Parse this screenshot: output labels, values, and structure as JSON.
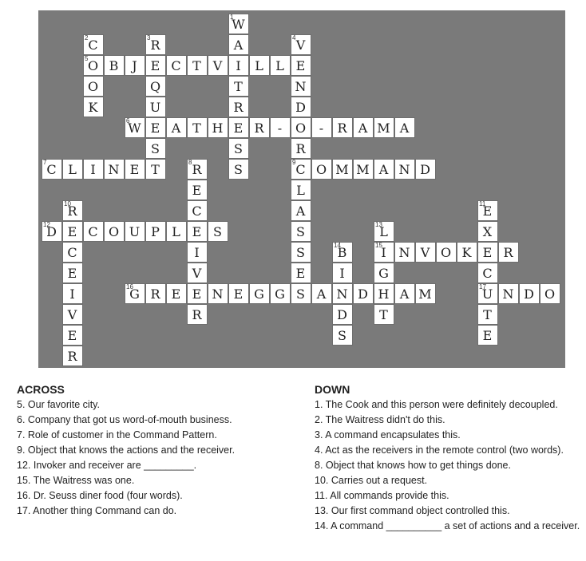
{
  "across": {
    "heading": "ACROSS",
    "clues": [
      "5. Our favorite city.",
      "6. Company that got us word-of-mouth business.",
      "7. Role of customer in the Command Pattern.",
      "9. Object that knows the actions and the receiver.",
      "12. Invoker and receiver are _________.",
      "15. The Waitress was one.",
      "16. Dr. Seuss diner food (four words).",
      "17. Another thing Command can do."
    ]
  },
  "down": {
    "heading": "DOWN",
    "clues": [
      "1. The Cook and this person were definitely decoupled.",
      "2. The Waitress didn't do this.",
      "3. A command encapsulates this.",
      "4. Act as the receivers in the remote control (two words).",
      "8. Object that knows how to get things done.",
      "10. Carries out a request.",
      "11. All commands provide this.",
      "13. Our first command object controlled this.",
      "14. A command __________ a set of actions and a receiver."
    ]
  },
  "grid": {
    "colors": {
      "background": "#7a7a7a",
      "cell": "#ffffff",
      "text": "#222222"
    },
    "entries": [
      {
        "number": "1",
        "direction": "down",
        "answer": "WAITRESS"
      },
      {
        "number": "2",
        "direction": "down",
        "answer": "COOK"
      },
      {
        "number": "3",
        "direction": "down",
        "answer": "REQUEST"
      },
      {
        "number": "4",
        "direction": "down",
        "answer": "VENDORCLASSES"
      },
      {
        "number": "5",
        "direction": "across",
        "answer": "OBJECTVILLE"
      },
      {
        "number": "6",
        "direction": "across",
        "answer": "WEATHER-O-RAMA"
      },
      {
        "number": "7",
        "direction": "across",
        "answer": "CLINET"
      },
      {
        "number": "8",
        "direction": "down",
        "answer": "RECEIVER"
      },
      {
        "number": "9",
        "direction": "across",
        "answer": "COMMAND"
      },
      {
        "number": "10",
        "direction": "down",
        "answer": "RECEIVER"
      },
      {
        "number": "11",
        "direction": "down",
        "answer": "EXECUTE"
      },
      {
        "number": "12",
        "direction": "across",
        "answer": "DECOUPLES"
      },
      {
        "number": "13",
        "direction": "down",
        "answer": "LIGHT"
      },
      {
        "number": "14",
        "direction": "down",
        "answer": "BINDS"
      },
      {
        "number": "15",
        "direction": "across",
        "answer": "INVOKER"
      },
      {
        "number": "16",
        "direction": "across",
        "answer": "GREENEGGSANDHAM"
      },
      {
        "number": "17",
        "direction": "across",
        "answer": "UNDO"
      }
    ]
  }
}
